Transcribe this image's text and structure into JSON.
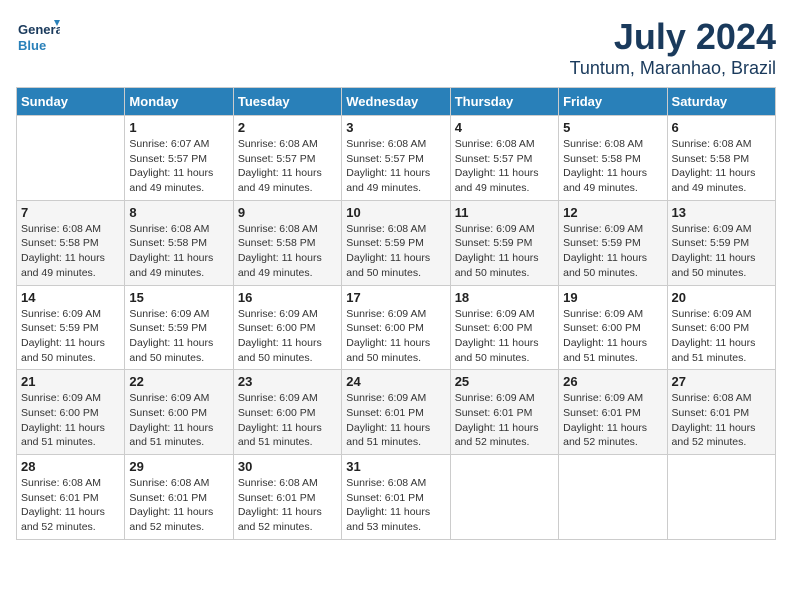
{
  "logo": {
    "line1": "General",
    "line2": "Blue"
  },
  "title": "July 2024",
  "subtitle": "Tuntum, Maranhao, Brazil",
  "days_header": [
    "Sunday",
    "Monday",
    "Tuesday",
    "Wednesday",
    "Thursday",
    "Friday",
    "Saturday"
  ],
  "weeks": [
    [
      {
        "num": "",
        "info": ""
      },
      {
        "num": "1",
        "info": "Sunrise: 6:07 AM\nSunset: 5:57 PM\nDaylight: 11 hours\nand 49 minutes."
      },
      {
        "num": "2",
        "info": "Sunrise: 6:08 AM\nSunset: 5:57 PM\nDaylight: 11 hours\nand 49 minutes."
      },
      {
        "num": "3",
        "info": "Sunrise: 6:08 AM\nSunset: 5:57 PM\nDaylight: 11 hours\nand 49 minutes."
      },
      {
        "num": "4",
        "info": "Sunrise: 6:08 AM\nSunset: 5:57 PM\nDaylight: 11 hours\nand 49 minutes."
      },
      {
        "num": "5",
        "info": "Sunrise: 6:08 AM\nSunset: 5:58 PM\nDaylight: 11 hours\nand 49 minutes."
      },
      {
        "num": "6",
        "info": "Sunrise: 6:08 AM\nSunset: 5:58 PM\nDaylight: 11 hours\nand 49 minutes."
      }
    ],
    [
      {
        "num": "7",
        "info": "Sunrise: 6:08 AM\nSunset: 5:58 PM\nDaylight: 11 hours\nand 49 minutes."
      },
      {
        "num": "8",
        "info": "Sunrise: 6:08 AM\nSunset: 5:58 PM\nDaylight: 11 hours\nand 49 minutes."
      },
      {
        "num": "9",
        "info": "Sunrise: 6:08 AM\nSunset: 5:58 PM\nDaylight: 11 hours\nand 49 minutes."
      },
      {
        "num": "10",
        "info": "Sunrise: 6:08 AM\nSunset: 5:59 PM\nDaylight: 11 hours\nand 50 minutes."
      },
      {
        "num": "11",
        "info": "Sunrise: 6:09 AM\nSunset: 5:59 PM\nDaylight: 11 hours\nand 50 minutes."
      },
      {
        "num": "12",
        "info": "Sunrise: 6:09 AM\nSunset: 5:59 PM\nDaylight: 11 hours\nand 50 minutes."
      },
      {
        "num": "13",
        "info": "Sunrise: 6:09 AM\nSunset: 5:59 PM\nDaylight: 11 hours\nand 50 minutes."
      }
    ],
    [
      {
        "num": "14",
        "info": "Sunrise: 6:09 AM\nSunset: 5:59 PM\nDaylight: 11 hours\nand 50 minutes."
      },
      {
        "num": "15",
        "info": "Sunrise: 6:09 AM\nSunset: 5:59 PM\nDaylight: 11 hours\nand 50 minutes."
      },
      {
        "num": "16",
        "info": "Sunrise: 6:09 AM\nSunset: 6:00 PM\nDaylight: 11 hours\nand 50 minutes."
      },
      {
        "num": "17",
        "info": "Sunrise: 6:09 AM\nSunset: 6:00 PM\nDaylight: 11 hours\nand 50 minutes."
      },
      {
        "num": "18",
        "info": "Sunrise: 6:09 AM\nSunset: 6:00 PM\nDaylight: 11 hours\nand 50 minutes."
      },
      {
        "num": "19",
        "info": "Sunrise: 6:09 AM\nSunset: 6:00 PM\nDaylight: 11 hours\nand 51 minutes."
      },
      {
        "num": "20",
        "info": "Sunrise: 6:09 AM\nSunset: 6:00 PM\nDaylight: 11 hours\nand 51 minutes."
      }
    ],
    [
      {
        "num": "21",
        "info": "Sunrise: 6:09 AM\nSunset: 6:00 PM\nDaylight: 11 hours\nand 51 minutes."
      },
      {
        "num": "22",
        "info": "Sunrise: 6:09 AM\nSunset: 6:00 PM\nDaylight: 11 hours\nand 51 minutes."
      },
      {
        "num": "23",
        "info": "Sunrise: 6:09 AM\nSunset: 6:00 PM\nDaylight: 11 hours\nand 51 minutes."
      },
      {
        "num": "24",
        "info": "Sunrise: 6:09 AM\nSunset: 6:01 PM\nDaylight: 11 hours\nand 51 minutes."
      },
      {
        "num": "25",
        "info": "Sunrise: 6:09 AM\nSunset: 6:01 PM\nDaylight: 11 hours\nand 52 minutes."
      },
      {
        "num": "26",
        "info": "Sunrise: 6:09 AM\nSunset: 6:01 PM\nDaylight: 11 hours\nand 52 minutes."
      },
      {
        "num": "27",
        "info": "Sunrise: 6:08 AM\nSunset: 6:01 PM\nDaylight: 11 hours\nand 52 minutes."
      }
    ],
    [
      {
        "num": "28",
        "info": "Sunrise: 6:08 AM\nSunset: 6:01 PM\nDaylight: 11 hours\nand 52 minutes."
      },
      {
        "num": "29",
        "info": "Sunrise: 6:08 AM\nSunset: 6:01 PM\nDaylight: 11 hours\nand 52 minutes."
      },
      {
        "num": "30",
        "info": "Sunrise: 6:08 AM\nSunset: 6:01 PM\nDaylight: 11 hours\nand 52 minutes."
      },
      {
        "num": "31",
        "info": "Sunrise: 6:08 AM\nSunset: 6:01 PM\nDaylight: 11 hours\nand 53 minutes."
      },
      {
        "num": "",
        "info": ""
      },
      {
        "num": "",
        "info": ""
      },
      {
        "num": "",
        "info": ""
      }
    ]
  ]
}
